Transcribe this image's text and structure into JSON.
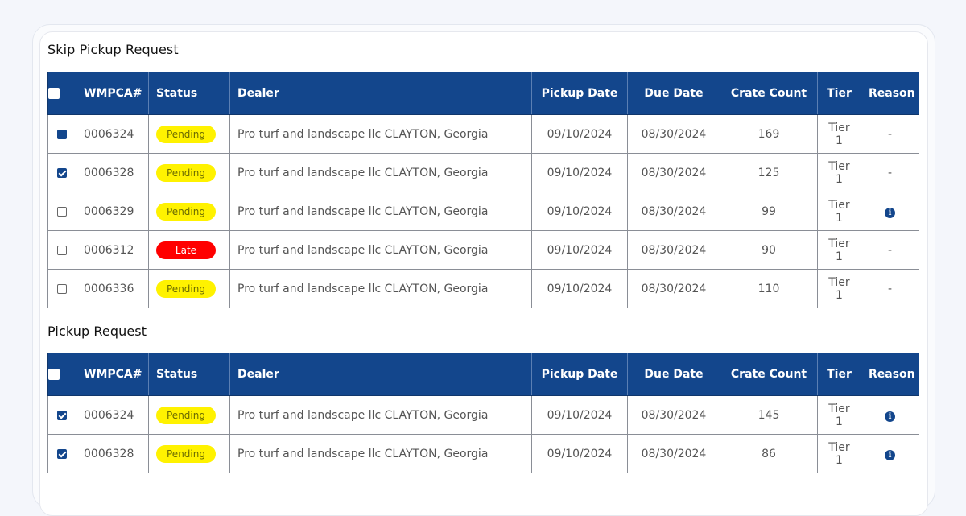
{
  "sections": [
    {
      "title": "Skip Pickup Request",
      "headers": [
        "WMPCA#",
        "Status",
        "Dealer",
        "Pickup Date",
        "Due Date",
        "Crate Count",
        "Tier",
        "Reason"
      ],
      "rows": [
        {
          "checkbox": "partial",
          "id": "0006324",
          "status": "Pending",
          "dealer": "Pro turf and landscape llc CLAYTON, Georgia",
          "pickup": "09/10/2024",
          "due": "08/30/2024",
          "crates": "169",
          "tier": "Tier 1",
          "reason": "-"
        },
        {
          "checkbox": "checked",
          "id": "0006328",
          "status": "Pending",
          "dealer": "Pro turf and landscape llc CLAYTON, Georgia",
          "pickup": "09/10/2024",
          "due": "08/30/2024",
          "crates": "125",
          "tier": "Tier 1",
          "reason": "-"
        },
        {
          "checkbox": "unchecked",
          "id": "0006329",
          "status": "Pending",
          "dealer": "Pro turf and landscape llc CLAYTON, Georgia",
          "pickup": "09/10/2024",
          "due": "08/30/2024",
          "crates": "99",
          "tier": "Tier 1",
          "reason": "info-icon"
        },
        {
          "checkbox": "unchecked",
          "id": "0006312",
          "status": "Late",
          "dealer": "Pro turf and landscape llc CLAYTON, Georgia",
          "pickup": "09/10/2024",
          "due": "08/30/2024",
          "crates": "90",
          "tier": "Tier 1",
          "reason": "-"
        },
        {
          "checkbox": "unchecked",
          "id": "0006336",
          "status": "Pending",
          "dealer": "Pro turf and landscape llc CLAYTON, Georgia",
          "pickup": "09/10/2024",
          "due": "08/30/2024",
          "crates": "110",
          "tier": "Tier 1",
          "reason": "-"
        }
      ]
    },
    {
      "title": "Pickup Request",
      "headers": [
        "WMPCA#",
        "Status",
        "Dealer",
        "Pickup Date",
        "Due Date",
        "Crate Count",
        "Tier",
        "Reason"
      ],
      "rows": [
        {
          "checkbox": "checked",
          "id": "0006324",
          "status": "Pending",
          "dealer": "Pro turf and landscape llc CLAYTON, Georgia",
          "pickup": "09/10/2024",
          "due": "08/30/2024",
          "crates": "145",
          "tier": "Tier 1",
          "reason": "info-icon"
        },
        {
          "checkbox": "checked",
          "id": "0006328",
          "status": "Pending",
          "dealer": "Pro turf and landscape llc CLAYTON, Georgia",
          "pickup": "09/10/2024",
          "due": "08/30/2024",
          "crates": "86",
          "tier": "Tier 1",
          "reason": "info-icon"
        }
      ]
    }
  ],
  "colors": {
    "header_bg": "#13468c",
    "pending": "#fff200",
    "late": "#ff0000"
  }
}
